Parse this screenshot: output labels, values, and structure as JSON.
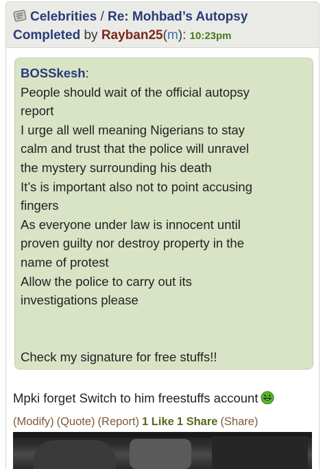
{
  "header": {
    "category": "Celebrities",
    "separator": "/",
    "thread_title_line1": "Re: Mohbad’s Autopsy",
    "thread_title_line2": "Completed",
    "by_label": "by",
    "author": "Rayban25",
    "gender_open": "(",
    "gender": "m",
    "gender_close": "):",
    "time": "10:23pm"
  },
  "quote": {
    "author": "BOSSkesh",
    "author_suffix": ":",
    "lines": [
      "People should wait of the official autopsy",
      "report",
      "I urge all well meaning Nigerians to stay",
      "calm and trust that the police will unravel",
      "the mystery surrounding his death",
      "It’s is important also not to point accusing",
      "fingers",
      "As everyone under law is innocent until",
      "proven guilty nor destroy property in the",
      "name of protest",
      "Allow the police to carry out its",
      "investigations please"
    ],
    "signature": "Check my signature for free stuffs!!"
  },
  "reply": {
    "text": "Mpki forget Switch to him freestuffs account"
  },
  "actions": {
    "modify": "(Modify)",
    "quote": "(Quote)",
    "report": "(Report)",
    "likes": "1 Like",
    "shares": "1 Share",
    "share": "(Share)"
  }
}
